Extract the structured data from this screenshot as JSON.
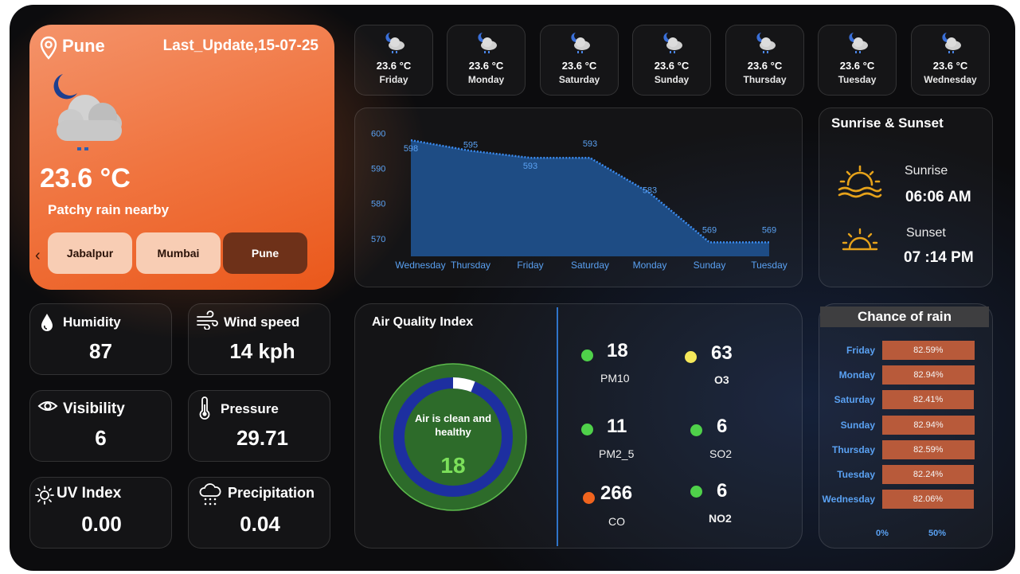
{
  "location": {
    "city": "Pune",
    "last_update": "Last_Update,15-07-25",
    "temperature": "23.6 °C",
    "condition": "Patchy rain nearby",
    "prev_icon": "chevron-left-icon",
    "cities": [
      "Jabalpur",
      "Mumbai",
      "Pune"
    ],
    "selected_city": "Pune"
  },
  "forecast": [
    {
      "temp": "23.6 °C",
      "day": "Friday"
    },
    {
      "temp": "23.6 °C",
      "day": "Monday"
    },
    {
      "temp": "23.6 °C",
      "day": "Saturday"
    },
    {
      "temp": "23.6 °C",
      "day": "Sunday"
    },
    {
      "temp": "23.6 °C",
      "day": "Thursday"
    },
    {
      "temp": "23.6 °C",
      "day": "Tuesday"
    },
    {
      "temp": "23.6 °C",
      "day": "Wednesday"
    }
  ],
  "chart_data": {
    "type": "area",
    "categories": [
      "Wednesday",
      "Thursday",
      "Friday",
      "Saturday",
      "Monday",
      "Sunday",
      "Tuesday"
    ],
    "values": [
      598,
      595,
      593,
      593,
      583,
      569,
      569
    ],
    "y_ticks": [
      600,
      590,
      580,
      570
    ],
    "ylim": [
      565,
      603
    ],
    "data_labels": true,
    "color": "#1f4f8a",
    "line_color": "#3b8cf0"
  },
  "sun": {
    "title": "Sunrise & Sunset",
    "sunrise_label": "Sunrise",
    "sunrise_time": "06:06 AM",
    "sunset_label": "Sunset",
    "sunset_time": "07 :14 PM",
    "icon_color": "#e6a21a"
  },
  "stats": {
    "humidity": {
      "label": "Humidity",
      "value": "87",
      "icon": "droplet-icon"
    },
    "wind": {
      "label": "Wind speed",
      "value": "14 kph",
      "icon": "wind-icon"
    },
    "visibility": {
      "label": "Visibility",
      "value": "6",
      "icon": "eye-icon"
    },
    "pressure": {
      "label": "Pressure",
      "value": "29.71",
      "icon": "thermometer-icon"
    },
    "uv": {
      "label": "UV Index",
      "value": "0.00",
      "icon": "sun-icon"
    },
    "precipitation": {
      "label": "Precipitation",
      "value": "0.04",
      "icon": "rain-cloud-icon"
    }
  },
  "aqi": {
    "title": "Air Quality Index",
    "status": "Air is clean and healthy",
    "value": "18",
    "gauge_fraction": 0.06,
    "pollutants": [
      {
        "name": "PM10",
        "value": "18",
        "color": "#4fd14a"
      },
      {
        "name": "O3",
        "value": "63",
        "color": "#f5e85a"
      },
      {
        "name": "PM2_5",
        "value": "11",
        "color": "#4fd14a"
      },
      {
        "name": "SO2",
        "value": "6",
        "color": "#4fd14a"
      },
      {
        "name": "CO",
        "value": "266",
        "color": "#f0641e"
      },
      {
        "name": "NO2",
        "value": "6",
        "color": "#4fd14a"
      }
    ]
  },
  "rain": {
    "title": "Chance of rain",
    "rows": [
      {
        "day": "Friday",
        "value": "82.59%",
        "fraction": 0.8259
      },
      {
        "day": "Monday",
        "value": "82.94%",
        "fraction": 0.8294
      },
      {
        "day": "Saturday",
        "value": "82.41%",
        "fraction": 0.8241
      },
      {
        "day": "Sunday",
        "value": "82.94%",
        "fraction": 0.8294
      },
      {
        "day": "Thursday",
        "value": "82.59%",
        "fraction": 0.8259
      },
      {
        "day": "Tuesday",
        "value": "82.24%",
        "fraction": 0.8224
      },
      {
        "day": "Wednesday",
        "value": "82.06%",
        "fraction": 0.8206
      }
    ],
    "axis_ticks": [
      "0%",
      "50%"
    ]
  }
}
